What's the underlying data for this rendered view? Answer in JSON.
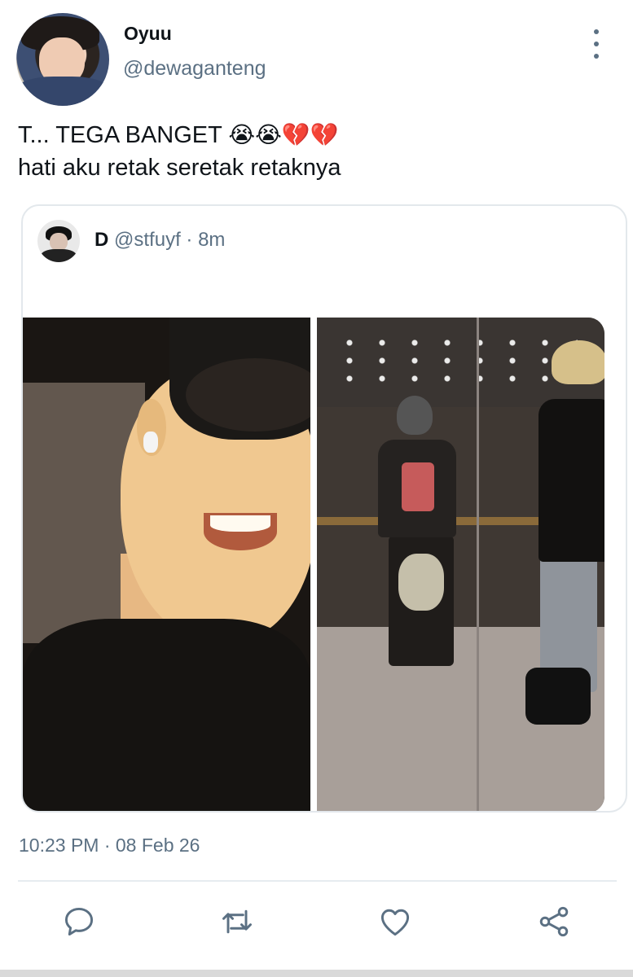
{
  "author": {
    "display_name": "Oyuu",
    "handle": "@dewaganteng"
  },
  "tweet": {
    "line1": "T... TEGA BANGET",
    "line1_emojis": "😭😭💔💔",
    "line2": "hati aku retak seretak retaknya",
    "timestamp": "10:23 PM · 08 Feb 26"
  },
  "quoted_tweet": {
    "display_name": "D",
    "handle": "@stfuyf",
    "separator": "·",
    "time": "8m"
  },
  "icons": {
    "more": "more-vertical-icon",
    "reply": "reply-icon",
    "retweet": "retweet-icon",
    "like": "heart-icon",
    "share": "share-icon"
  },
  "colors": {
    "text": "#0f1419",
    "secondary": "#5b7083",
    "border": "#e3e8ec",
    "icon": "#5b7083"
  }
}
